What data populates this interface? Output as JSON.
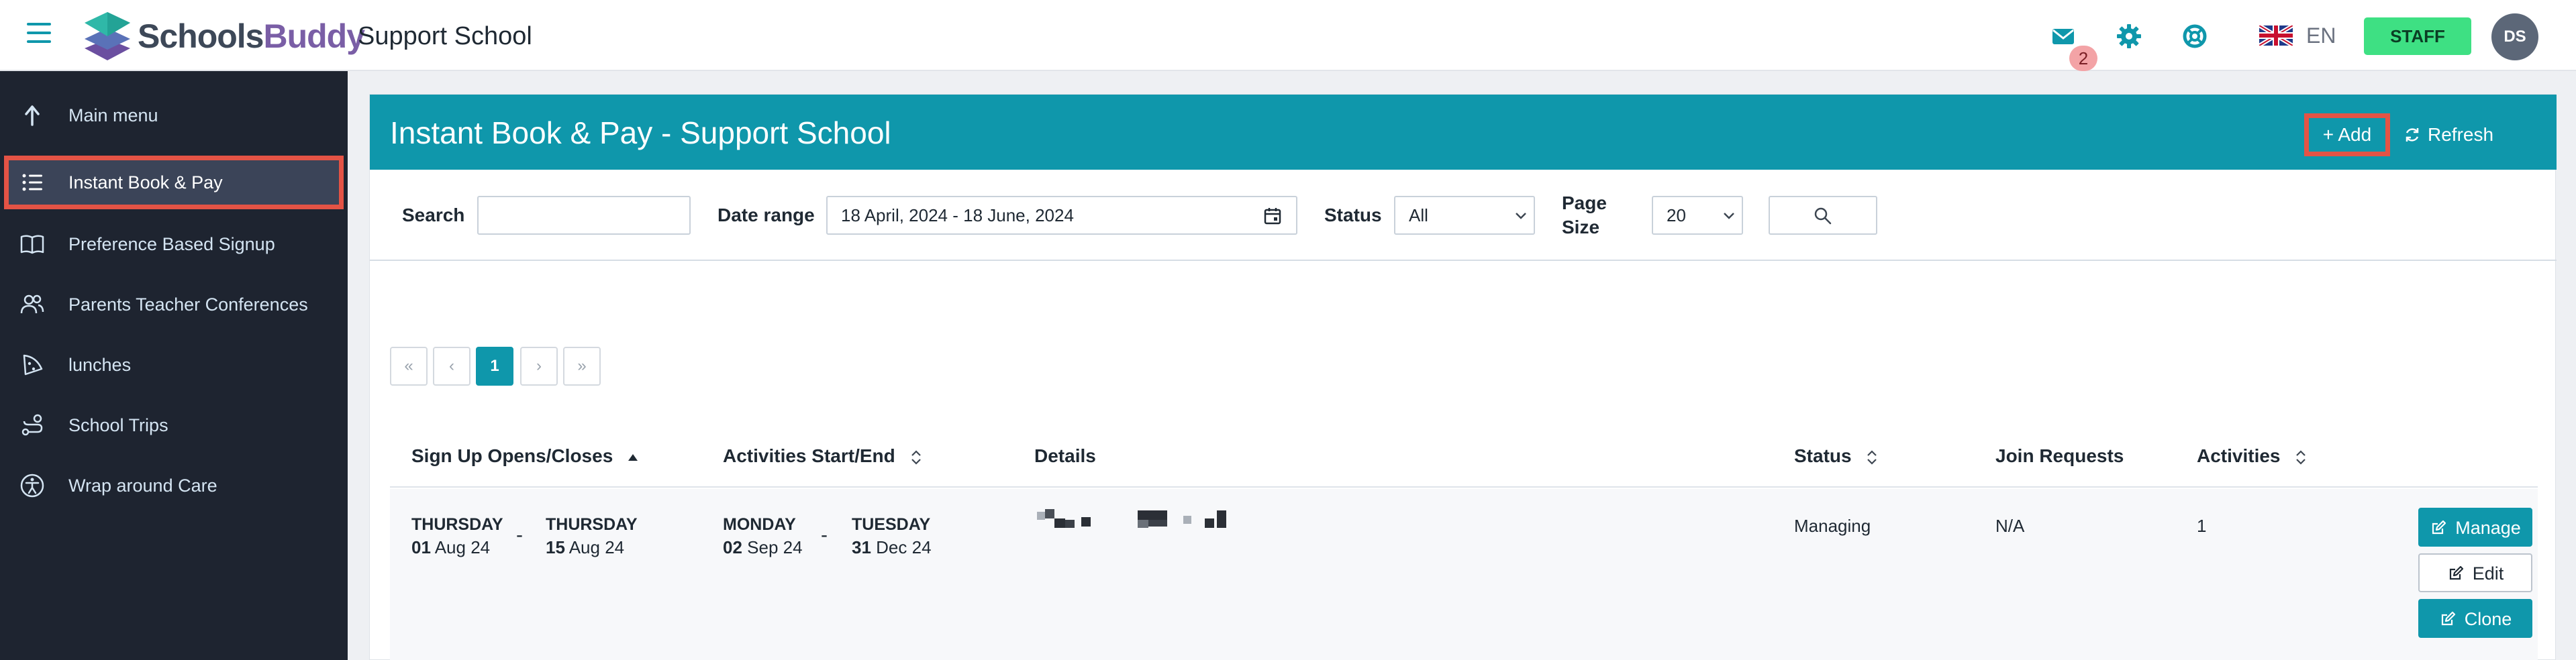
{
  "header": {
    "logo_part1": "Schools",
    "logo_part2": "Buddy",
    "school_name": "Support School",
    "message_count": "2",
    "language": "EN",
    "role_button": "STAFF",
    "avatar_initials": "DS",
    "icons": [
      "hamburger-icon",
      "envelope-icon",
      "gear-icon",
      "lifebuoy-icon",
      "uk-flag-icon"
    ],
    "brand_color": "#0f97ab",
    "staff_color": "#3ee083"
  },
  "sidebar": {
    "items": [
      {
        "label": "Main menu",
        "icon": "arrow-up-icon"
      },
      {
        "label": "Instant Book & Pay",
        "icon": "list-icon",
        "active": true
      },
      {
        "label": "Preference Based Signup",
        "icon": "book-icon"
      },
      {
        "label": "Parents Teacher Conferences",
        "icon": "users-icon"
      },
      {
        "label": "lunches",
        "icon": "pizza-icon"
      },
      {
        "label": "School Trips",
        "icon": "route-icon"
      },
      {
        "label": "Wrap around Care",
        "icon": "accessibility-icon"
      }
    ]
  },
  "panel": {
    "title": "Instant Book & Pay - Support School",
    "add_label": "Add",
    "refresh_label": "Refresh"
  },
  "filters": {
    "search_label": "Search",
    "search_value": "",
    "date_range_label": "Date range",
    "date_range_value": "18 April, 2024 - 18 June, 2024",
    "status_label": "Status",
    "status_value": "All",
    "page_size_label_1": "Page",
    "page_size_label_2": "Size",
    "page_size_value": "20"
  },
  "pager": {
    "first": "«",
    "prev": "‹",
    "current": "1",
    "next": "›",
    "last": "»"
  },
  "table": {
    "columns": [
      "Sign Up Opens/Closes",
      "Activities Start/End",
      "Details",
      "Status",
      "Join Requests",
      "Activities"
    ],
    "rows": [
      {
        "signup_open_day": "THURSDAY",
        "signup_open_date_num": "01",
        "signup_open_date_rest": " Aug 24",
        "signup_close_day": "THURSDAY",
        "signup_close_date_num": "15",
        "signup_close_date_rest": " Aug 24",
        "activity_start_day": "MONDAY",
        "activity_start_date_num": "02",
        "activity_start_date_rest": " Sep 24",
        "activity_end_day": "TUESDAY",
        "activity_end_date_num": "31",
        "activity_end_date_rest": " Dec 24",
        "status": "Managing",
        "join_requests": "N/A",
        "activities": "1",
        "manage_label": "Manage",
        "edit_label": "Edit",
        "clone_label": "Clone"
      }
    ]
  }
}
